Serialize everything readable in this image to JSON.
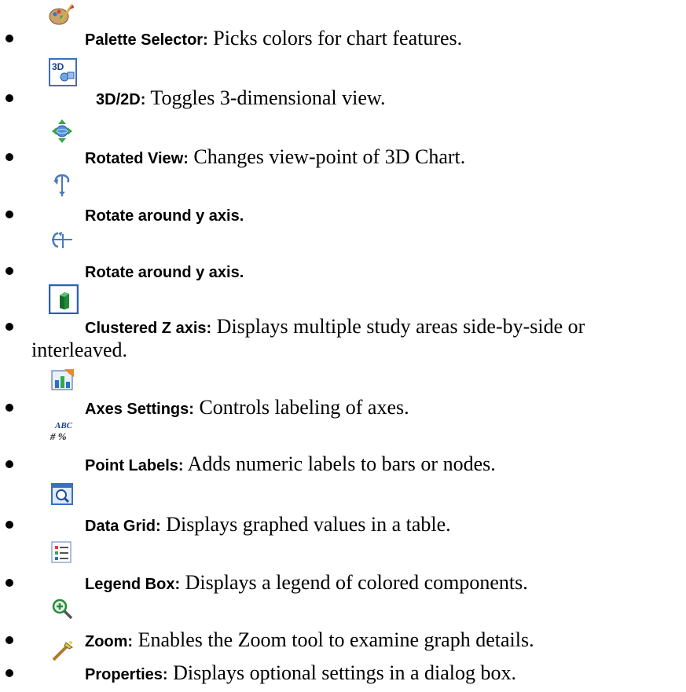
{
  "items": [
    {
      "icon": "palette-icon",
      "term": "Palette Selector:",
      "desc": " Picks colors for chart features."
    },
    {
      "icon": "3d-2d-icon",
      "term": "3D/2D:",
      "desc": " Toggles 3-dimensional view."
    },
    {
      "icon": "rotated-view-icon",
      "term": "Rotated View:",
      "desc": "  Changes view-point of 3D Chart."
    },
    {
      "icon": "rotate-y-axis-icon",
      "term": "Rotate around y axis.",
      "desc": ""
    },
    {
      "icon": "rotate-x-axis-icon",
      "term": "Rotate around y axis.",
      "desc": ""
    },
    {
      "icon": "clustered-z-axis-icon",
      "term": "Clustered Z axis:",
      "desc": " Displays multiple study areas side-by-side or",
      "desc_line2": "interleaved."
    },
    {
      "icon": "axes-settings-icon",
      "term": "Axes Settings:",
      "desc": " Controls labeling of axes."
    },
    {
      "icon": "point-labels-icon",
      "term": "Point Labels:",
      "desc": " Adds numeric labels to bars or nodes.",
      "icon_text_top": "ABC",
      "icon_text_bottom": "# %"
    },
    {
      "icon": "data-grid-icon",
      "term": "Data Grid:",
      "desc": " Displays graphed values in a table."
    },
    {
      "icon": "legend-box-icon",
      "term": "Legend Box:",
      "desc": " Displays a legend of colored components."
    },
    {
      "icon": "zoom-icon",
      "term": "Zoom:",
      "desc": " Enables the Zoom tool to examine graph details."
    },
    {
      "icon": "properties-icon",
      "term": "Properties:",
      "desc": " Displays optional settings in a dialog box."
    }
  ]
}
